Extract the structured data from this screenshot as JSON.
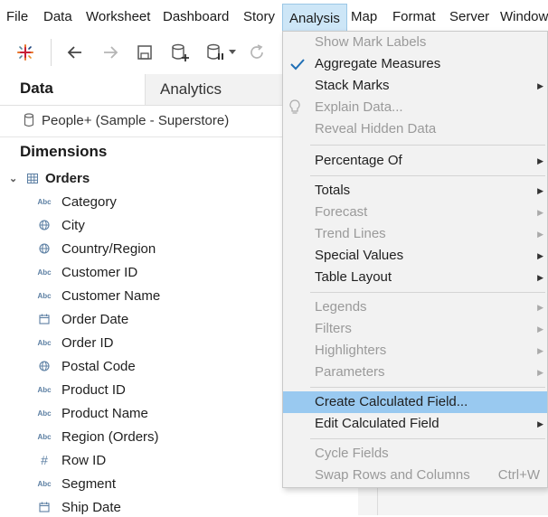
{
  "menubar": {
    "items": [
      "File",
      "Data",
      "Worksheet",
      "Dashboard",
      "Story",
      "Analysis",
      "Map",
      "Format",
      "Server",
      "Window"
    ],
    "active": "Analysis"
  },
  "toolbar": {
    "icons": [
      "tableau-logo-icon",
      "back-arrow-icon",
      "forward-arrow-icon",
      "save-icon",
      "new-data-source-icon",
      "pause-updates-icon",
      "refresh-icon"
    ]
  },
  "side_pane": {
    "tabs": [
      "Data",
      "Analytics"
    ],
    "data_source": "People+ (Sample - Superstore)",
    "dimensions_title": "Dimensions",
    "table_name": "Orders",
    "fields": [
      {
        "name": "Category",
        "type": "Abc"
      },
      {
        "name": "City",
        "type": "geo"
      },
      {
        "name": "Country/Region",
        "type": "geo"
      },
      {
        "name": "Customer ID",
        "type": "Abc"
      },
      {
        "name": "Customer Name",
        "type": "Abc"
      },
      {
        "name": "Order Date",
        "type": "date"
      },
      {
        "name": "Order ID",
        "type": "Abc"
      },
      {
        "name": "Postal Code",
        "type": "geo"
      },
      {
        "name": "Product ID",
        "type": "Abc"
      },
      {
        "name": "Product Name",
        "type": "Abc"
      },
      {
        "name": "Region (Orders)",
        "type": "Abc"
      },
      {
        "name": "Row ID",
        "type": "#"
      },
      {
        "name": "Segment",
        "type": "Abc"
      },
      {
        "name": "Ship Date",
        "type": "date"
      }
    ]
  },
  "analysis_menu": {
    "show_mark_labels": "Show Mark Labels",
    "aggregate_measures": "Aggregate Measures",
    "stack_marks": "Stack Marks",
    "explain_data": "Explain Data...",
    "reveal_hidden_data": "Reveal Hidden Data",
    "percentage_of": "Percentage Of",
    "totals": "Totals",
    "forecast": "Forecast",
    "trend_lines": "Trend Lines",
    "special_values": "Special Values",
    "table_layout": "Table Layout",
    "legends": "Legends",
    "filters": "Filters",
    "highlighters": "Highlighters",
    "parameters": "Parameters",
    "create_calculated_field": "Create Calculated Field...",
    "edit_calculated_field": "Edit Calculated Field",
    "cycle_fields": "Cycle Fields",
    "swap_rows_and_columns": "Swap Rows and Columns",
    "swap_shortcut": "Ctrl+W"
  },
  "colors": {
    "menu_highlight": "#99c9f0",
    "active_menu": "#cde6f7",
    "check": "#1f6fb5"
  }
}
